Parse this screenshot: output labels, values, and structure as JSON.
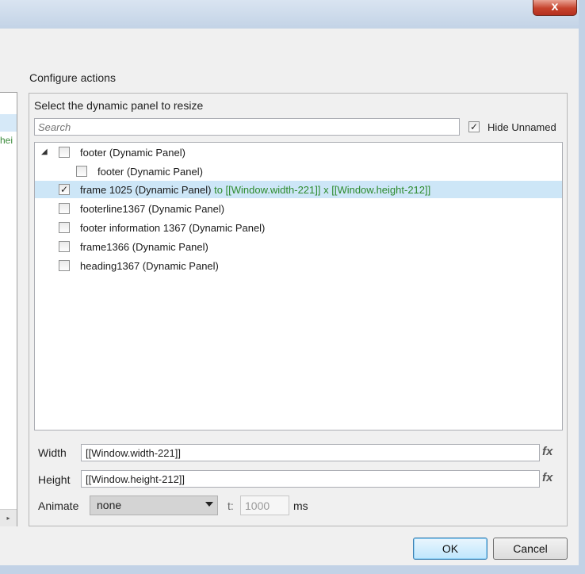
{
  "window": {
    "close_glyph": "x"
  },
  "left_panel": {
    "fragment_text": "hei",
    "scroll_glyph": "▸"
  },
  "configure": {
    "title": "Configure actions",
    "select_label": "Select the dynamic panel to resize",
    "search_placeholder": "Search",
    "hide_unnamed": {
      "label": "Hide Unnamed",
      "checked": true
    }
  },
  "tree": {
    "items": [
      {
        "name": "footer (Dynamic Panel)",
        "checked": false,
        "expanded": true,
        "level": 0
      },
      {
        "name": "footer (Dynamic Panel)",
        "checked": false,
        "level": 1
      },
      {
        "name": "frame 1025 (Dynamic Panel)",
        "checked": true,
        "level": 0,
        "selected": true,
        "action": "to [[Window.width-221]] x [[Window.height-212]]"
      },
      {
        "name": "footerline1367 (Dynamic Panel)",
        "checked": false,
        "level": 0
      },
      {
        "name": "footer information 1367 (Dynamic Panel)",
        "checked": false,
        "level": 0
      },
      {
        "name": "frame1366 (Dynamic Panel)",
        "checked": false,
        "level": 0
      },
      {
        "name": "heading1367 (Dynamic Panel)",
        "checked": false,
        "level": 0
      }
    ]
  },
  "width": {
    "label": "Width",
    "value": "[[Window.width-221]]",
    "fx": "fx"
  },
  "height": {
    "label": "Height",
    "value": "[[Window.height-212]]",
    "fx": "fx"
  },
  "animate": {
    "label": "Animate",
    "value": "none",
    "t_label": "t:",
    "t_value": "1000",
    "unit": "ms"
  },
  "buttons": {
    "ok": "OK",
    "cancel": "Cancel"
  },
  "icons": {
    "check": "✓",
    "expander": "◢"
  }
}
